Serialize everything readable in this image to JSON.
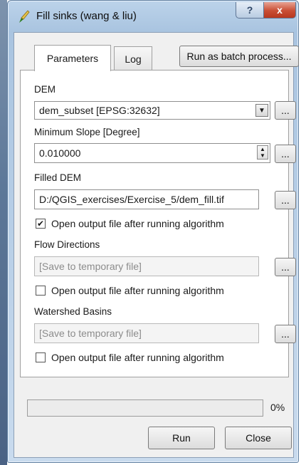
{
  "window": {
    "title": "Fill sinks (wang & liu)",
    "help_label": "?",
    "close_label": "x"
  },
  "tabs": [
    {
      "label": "Parameters",
      "active": true
    },
    {
      "label": "Log",
      "active": false
    }
  ],
  "batch_button": "Run as batch process...",
  "params": {
    "dem_label": "DEM",
    "dem_value": "dem_subset [EPSG:32632]",
    "slope_label": "Minimum Slope [Degree]",
    "slope_value": "0.010000",
    "filled_label": "Filled DEM",
    "filled_value": "D:/QGIS_exercises/Exercise_5/dem_fill.tif",
    "filled_open_label": "Open output file after running algorithm",
    "filled_open_checked": true,
    "flow_label": "Flow Directions",
    "flow_placeholder": "[Save to temporary file]",
    "flow_open_label": "Open output file after running algorithm",
    "flow_open_checked": false,
    "basins_label": "Watershed Basins",
    "basins_placeholder": "[Save to temporary file]",
    "basins_open_label": "Open output file after running algorithm",
    "basins_open_checked": false,
    "browse_label": "..."
  },
  "progress": {
    "value": 0,
    "text": "0%"
  },
  "buttons": {
    "run": "Run",
    "close": "Close"
  },
  "icons": {
    "app": "qgis-brush-icon",
    "check": "checkmark-icon",
    "dropdown": "chevron-down-icon"
  }
}
